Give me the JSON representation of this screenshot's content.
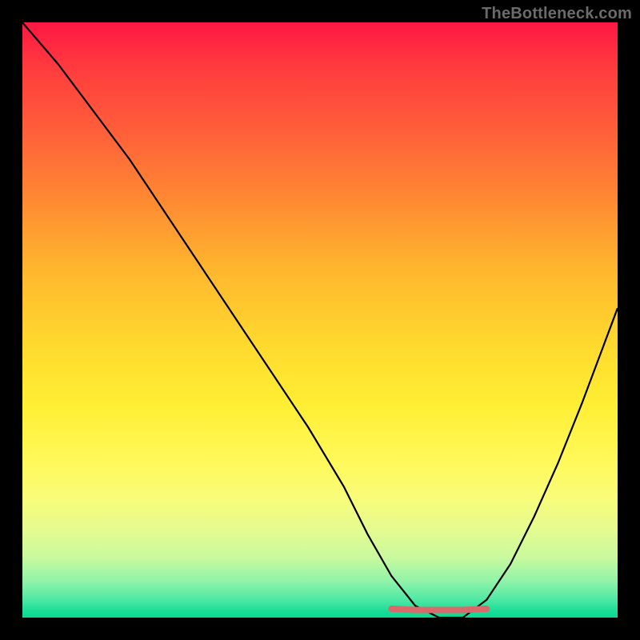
{
  "watermark": "TheBottleneck.com",
  "gradient": {
    "top": "#ff1744",
    "mid": "#ffee33",
    "bottom": "#0bd890"
  },
  "chart_data": {
    "type": "line",
    "title": "",
    "xlabel": "",
    "ylabel": "",
    "xlim": [
      0,
      100
    ],
    "ylim": [
      0,
      100
    ],
    "grid": false,
    "legend": false,
    "series": [
      {
        "name": "bottleneck-curve",
        "x": [
          0,
          6,
          12,
          18,
          24,
          30,
          36,
          42,
          48,
          54,
          58,
          62,
          66,
          70,
          74,
          78,
          82,
          86,
          90,
          94,
          100
        ],
        "values": [
          100,
          93,
          85,
          77,
          68,
          59,
          50,
          41,
          32,
          22,
          14,
          7,
          2,
          0,
          0,
          3,
          9,
          17,
          26,
          36,
          52
        ]
      },
      {
        "name": "optimal-zone",
        "x": [
          62,
          66,
          70,
          74,
          78
        ],
        "values": [
          1,
          0.5,
          0.5,
          0.5,
          1
        ]
      }
    ],
    "annotations": []
  }
}
